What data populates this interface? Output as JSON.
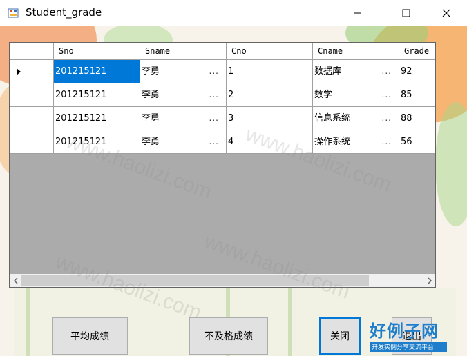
{
  "window": {
    "title": "Student_grade"
  },
  "grid": {
    "columns": [
      "Sno",
      "Sname",
      "Cno",
      "Cname",
      "Grade"
    ],
    "rows": [
      {
        "Sno": "201215121",
        "Sname": "李勇",
        "Cno": "1",
        "Cname": "数据库",
        "Grade": "92"
      },
      {
        "Sno": "201215121",
        "Sname": "李勇",
        "Cno": "2",
        "Cname": "数学",
        "Grade": "85"
      },
      {
        "Sno": "201215121",
        "Sname": "李勇",
        "Cno": "3",
        "Cname": "信息系统",
        "Grade": "88"
      },
      {
        "Sno": "201215121",
        "Sname": "李勇",
        "Cno": "4",
        "Cname": "操作系统",
        "Grade": "56"
      }
    ],
    "overflow_indicator": "..."
  },
  "buttons": {
    "average": "平均成绩",
    "failing": "不及格成绩",
    "close": "关闭",
    "exit": "退出"
  },
  "watermark": {
    "text": "www.haolizi.com"
  },
  "brand": {
    "title": "好例子网",
    "subtitle": "开发实例分享交流平台"
  },
  "colors": {
    "selection": "#0078d7",
    "grid_background": "#ababab",
    "brand": "#1e7ecb"
  }
}
